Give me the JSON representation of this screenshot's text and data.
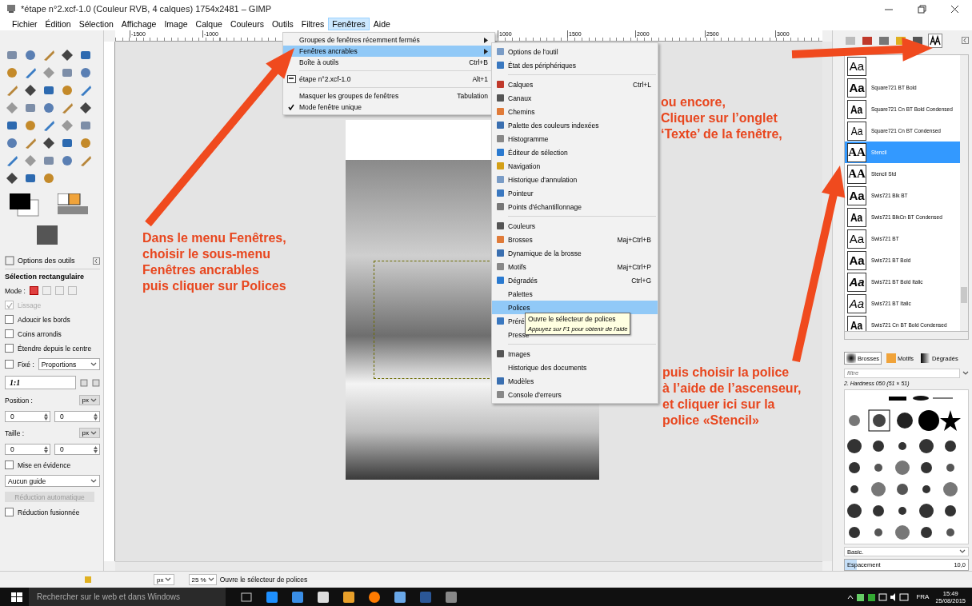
{
  "window": {
    "title": "*étape n°2.xcf-1.0 (Couleur RVB, 4 calques) 1754x2481 – GIMP"
  },
  "menubar": [
    {
      "label": "Fichier",
      "selected": false
    },
    {
      "label": "Édition",
      "selected": false
    },
    {
      "label": "Sélection",
      "selected": false
    },
    {
      "label": "Affichage",
      "selected": false
    },
    {
      "label": "Image",
      "selected": false
    },
    {
      "label": "Calque",
      "selected": false
    },
    {
      "label": "Couleurs",
      "selected": false
    },
    {
      "label": "Outils",
      "selected": false
    },
    {
      "label": "Filtres",
      "selected": false
    },
    {
      "label": "Fenêtres",
      "selected": true
    },
    {
      "label": "Aide",
      "selected": false
    }
  ],
  "ruler": {
    "labels": [
      "-1500",
      "-1000",
      "1000",
      "1500",
      "2000",
      "2500",
      "3000"
    ]
  },
  "tool_options": {
    "tab": "Options des outils",
    "title": "Sélection rectangulaire",
    "mode_label": "Mode :",
    "modes": [
      {
        "selected": true
      },
      {
        "selected": false
      },
      {
        "selected": false
      },
      {
        "selected": false
      }
    ],
    "options": [
      {
        "kind": "check",
        "label": "Lissage",
        "checked": true,
        "disabled": true
      },
      {
        "kind": "check",
        "label": "Adoucir les bords",
        "checked": false,
        "disabled": false
      },
      {
        "kind": "check",
        "label": "Coins arrondis",
        "checked": false,
        "disabled": false
      },
      {
        "kind": "check",
        "label": "Étendre depuis le centre",
        "checked": false,
        "disabled": false
      },
      {
        "kind": "fixed",
        "label": "Fixé :",
        "checked": false,
        "value": "Proportions"
      },
      {
        "kind": "field",
        "value": "1:1"
      },
      {
        "kind": "coords",
        "label": "Position :",
        "unit": "px",
        "values": [
          "0",
          "0"
        ]
      },
      {
        "kind": "coords",
        "label": "Taille :",
        "unit": "px",
        "values": [
          "0",
          "0"
        ]
      },
      {
        "kind": "check",
        "label": "Mise en évidence",
        "checked": false,
        "disabled": false
      },
      {
        "kind": "dropdown",
        "value": "Aucun guide"
      },
      {
        "kind": "button",
        "label": "Réduction automatique",
        "disabled": true
      },
      {
        "kind": "check",
        "label": "Réduction fusionnée",
        "checked": false,
        "disabled": false
      }
    ]
  },
  "windows_menu": [
    {
      "kind": "submenu",
      "label": "Groupes de fenêtres récemment fermés",
      "selected": false
    },
    {
      "kind": "submenu",
      "label": "Fenêtres ancrables",
      "selected": true
    },
    {
      "kind": "item",
      "label": "Boîte à outils",
      "shortcut": "Ctrl+B",
      "selected": false
    },
    {
      "kind": "separator"
    },
    {
      "kind": "image",
      "label": "étape n°2.xcf-1.0",
      "shortcut": "Alt+1",
      "selected": false
    },
    {
      "kind": "separator"
    },
    {
      "kind": "item",
      "label": "Masquer les groupes de fenêtres",
      "shortcut": "Tabulation",
      "selected": false
    },
    {
      "kind": "check",
      "label": "Mode fenêtre unique",
      "checked": true,
      "selected": false
    }
  ],
  "dockable_menu": [
    {
      "kind": "item",
      "label": "Options de l'outil",
      "icon": true,
      "selected": false
    },
    {
      "kind": "item",
      "label": "État des périphériques",
      "icon": true,
      "selected": false
    },
    {
      "kind": "separator"
    },
    {
      "kind": "item",
      "label": "Calques",
      "shortcut": "Ctrl+L",
      "icon": true,
      "selected": false
    },
    {
      "kind": "item",
      "label": "Canaux",
      "icon": true,
      "selected": false
    },
    {
      "kind": "item",
      "label": "Chemins",
      "icon": true,
      "selected": false
    },
    {
      "kind": "item",
      "label": "Palette des couleurs indexées",
      "icon": true,
      "selected": false
    },
    {
      "kind": "item",
      "label": "Histogramme",
      "icon": true,
      "selected": false
    },
    {
      "kind": "item",
      "label": "Éditeur de sélection",
      "icon": true,
      "selected": false
    },
    {
      "kind": "item",
      "label": "Navigation",
      "icon": true,
      "selected": false
    },
    {
      "kind": "item",
      "label": "Historique d'annulation",
      "icon": true,
      "selected": false
    },
    {
      "kind": "item",
      "label": "Pointeur",
      "icon": true,
      "selected": false
    },
    {
      "kind": "item",
      "label": "Points d'échantillonnage",
      "icon": true,
      "selected": false
    },
    {
      "kind": "separator"
    },
    {
      "kind": "item",
      "label": "Couleurs",
      "icon": true,
      "selected": false
    },
    {
      "kind": "item",
      "label": "Brosses",
      "shortcut": "Maj+Ctrl+B",
      "icon": true,
      "selected": false
    },
    {
      "kind": "item",
      "label": "Dynamique de la brosse",
      "icon": true,
      "selected": false
    },
    {
      "kind": "item",
      "label": "Motifs",
      "shortcut": "Maj+Ctrl+P",
      "icon": true,
      "selected": false
    },
    {
      "kind": "item",
      "label": "Dégradés",
      "shortcut": "Ctrl+G",
      "icon": true,
      "selected": false
    },
    {
      "kind": "item",
      "label": "Palettes",
      "icon": false,
      "selected": false
    },
    {
      "kind": "item",
      "label": "Polices",
      "icon": false,
      "selected": true
    },
    {
      "kind": "item",
      "label": "Préré",
      "icon": true,
      "selected": false
    },
    {
      "kind": "item",
      "label": "Presse",
      "icon": false,
      "selected": false
    },
    {
      "kind": "separator"
    },
    {
      "kind": "item",
      "label": "Images",
      "icon": true,
      "selected": false
    },
    {
      "kind": "item",
      "label": "Historique des documents",
      "icon": false,
      "selected": false
    },
    {
      "kind": "item",
      "label": "Modèles",
      "icon": true,
      "selected": false
    },
    {
      "kind": "item",
      "label": "Console d'erreurs",
      "icon": true,
      "selected": false
    }
  ],
  "tooltip": {
    "text": "Ouvre le sélecteur de polices",
    "hint": "Appuyez sur F1 pour obtenir de l'aide"
  },
  "notes": [
    {
      "lines": [
        "Dans le menu Fenêtres,",
        "choisir le sous-menu",
        "Fenêtres ancrables",
        "puis cliquer sur Polices"
      ]
    },
    {
      "lines": [
        "ou encore,",
        "Cliquer sur l’onglet",
        "‘Texte’ de la fenêtre,"
      ]
    },
    {
      "lines": [
        "puis choisir la police",
        "à l’aide de  l’ascenseur,",
        "et cliquer ici sur la",
        "police «Stencil»"
      ]
    }
  ],
  "dock_tabs": [
    {
      "selected": false
    },
    {
      "selected": false
    },
    {
      "selected": false
    },
    {
      "selected": false
    },
    {
      "selected": false
    },
    {
      "selected": true
    }
  ],
  "fonts": [
    {
      "preview": "Aa",
      "kind": "regular",
      "selected": false
    },
    {
      "name": "Square721 BT Bold",
      "preview": "Aa",
      "kind": "bold",
      "selected": false
    },
    {
      "name": "Square721 Cn BT Bold Condensed",
      "preview": "Aa",
      "kind": "condbold",
      "selected": false
    },
    {
      "name": "Square721 Cn BT Condensed",
      "preview": "Aa",
      "kind": "cond",
      "selected": false
    },
    {
      "name": "Stencil",
      "preview": "AA",
      "kind": "stencil",
      "selected": true
    },
    {
      "name": "Stencil Std",
      "preview": "AA",
      "kind": "stencil",
      "selected": false
    },
    {
      "name": "Swis721 Blk BT",
      "preview": "Aa",
      "kind": "bold",
      "selected": false
    },
    {
      "name": "Swis721 BlkCn BT Condensed",
      "preview": "Aa",
      "kind": "condbold",
      "selected": false
    },
    {
      "name": "Swis721 BT",
      "preview": "Aa",
      "kind": "regular",
      "selected": false
    },
    {
      "name": "Swis721 BT Bold",
      "preview": "Aa",
      "kind": "bold",
      "selected": false
    },
    {
      "name": "Swis721 BT Bold Italic",
      "preview": "Aa",
      "kind": "bolditalic",
      "selected": false
    },
    {
      "name": "Swis721 BT Italic",
      "preview": "Aa",
      "kind": "italic",
      "selected": false
    },
    {
      "name": "Swis721 Cn BT Bold Condensed",
      "preview": "Aa",
      "kind": "condbold",
      "selected": false
    }
  ],
  "brushes": {
    "tabs": [
      {
        "label": "Brosses",
        "selected": true
      },
      {
        "label": "Motifs",
        "selected": false
      },
      {
        "label": "Dégradés",
        "selected": false
      }
    ],
    "filter_placeholder": "filtre",
    "brush_name": "2. Hardness 050 (51 × 51)",
    "preset": "Basic.",
    "spacing": {
      "label": "Espacement",
      "value": "10,0",
      "level": 0.1
    }
  },
  "status_bar": {
    "unit": "px",
    "zoom": "25 %",
    "message": "Ouvre le sélecteur de polices"
  },
  "taskbar": {
    "search_placeholder": "Rechercher sur le web et dans Windows",
    "language": "FRA",
    "time": "15:49",
    "date": "25/08/2015"
  }
}
